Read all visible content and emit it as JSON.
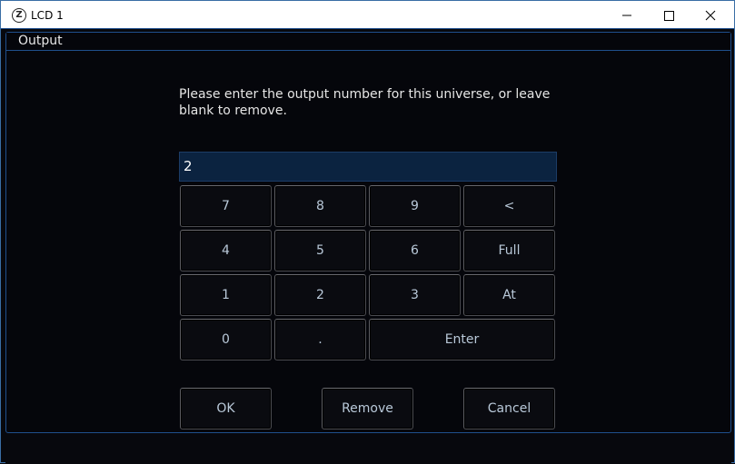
{
  "window": {
    "title": "LCD 1",
    "app_icon_letter": "Z"
  },
  "panel": {
    "title": "Output"
  },
  "dialog": {
    "prompt": "Please enter the output number for this universe, or leave blank to remove.",
    "entry_value": "2"
  },
  "keypad": {
    "k7": "7",
    "k8": "8",
    "k9": "9",
    "back": "<",
    "k4": "4",
    "k5": "5",
    "k6": "6",
    "full": "Full",
    "k1": "1",
    "k2": "2",
    "k3": "3",
    "at": "At",
    "k0": "0",
    "dot": ".",
    "enter": "Enter"
  },
  "actions": {
    "ok": "OK",
    "remove": "Remove",
    "cancel": "Cancel"
  },
  "colors": {
    "background": "#07080d",
    "accent_border": "#1f4f8c",
    "entry_fill": "#0b2340",
    "key_text": "#b9c9d9"
  }
}
